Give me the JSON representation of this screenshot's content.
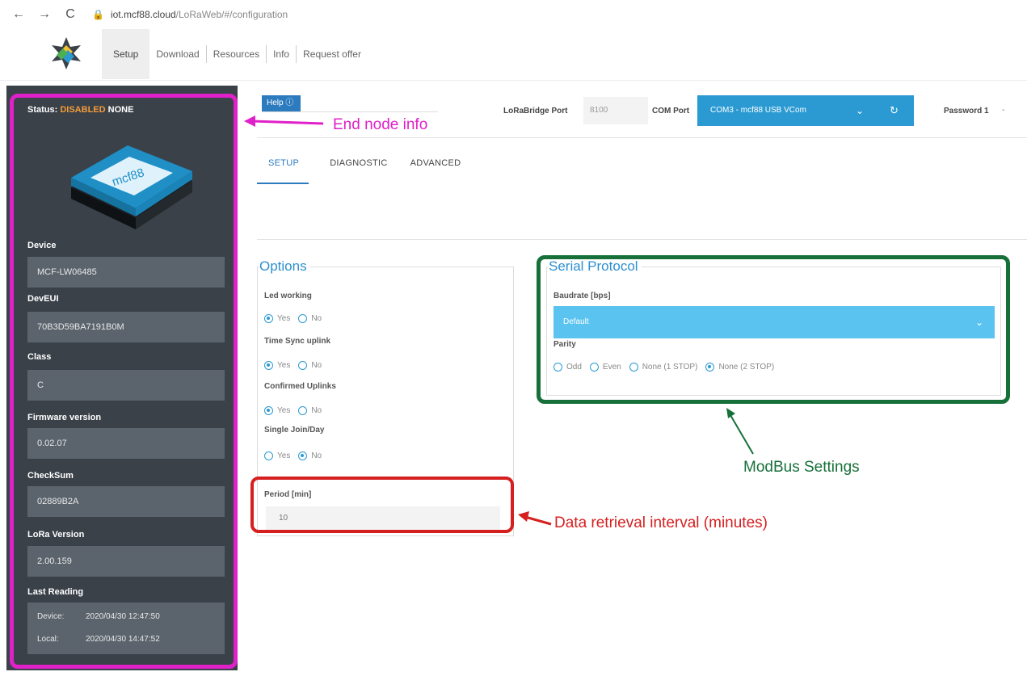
{
  "browser": {
    "back_icon": "←",
    "forward_icon": "→",
    "reload_icon": "C",
    "lock_icon": "🔒",
    "url_host": "iot.mcf88.cloud",
    "url_path": "/LoRaWeb/#/configuration"
  },
  "header": {
    "tabs": [
      "Setup",
      "Download",
      "Resources",
      "Info",
      "Request offer"
    ]
  },
  "sidebar": {
    "status_label": "Status:",
    "status_state": "DISABLED",
    "status_mode": "NONE",
    "device_label": "Device",
    "device_value": "MCF-LW06485",
    "deveui_label": "DevEUI",
    "deveui_value": "70B3D59BA7191B0M",
    "class_label": "Class",
    "class_value": "C",
    "firmware_label": "Firmware version",
    "firmware_value": "0.02.07",
    "checksum_label": "CheckSum",
    "checksum_value": "02889B2A",
    "lora_label": "LoRa Version",
    "lora_value": "2.00.159",
    "last_reading_label": "Last Reading",
    "reading_device_key": "Device:",
    "reading_device_value": "2020/04/30 12:47:50",
    "reading_local_key": "Local:",
    "reading_local_value": "2020/04/30 14:47:52",
    "device_logo_text": "mcf88"
  },
  "topbar": {
    "help_label": "Help ⓘ",
    "lorabridge_port_label": "LoRaBridge Port",
    "lorabridge_port_value": "8100",
    "com_port_label": "COM Port",
    "com_port_value": "COM3 - mcf88 USB VCom",
    "password_label": "Password 1",
    "password_value": "-",
    "chevron_icon": "⌄",
    "refresh_icon": "↻"
  },
  "subtabs": [
    "SETUP",
    "DIAGNOSTIC",
    "ADVANCED"
  ],
  "options": {
    "legend": "Options",
    "led_label": "Led working",
    "timesync_label": "Time Sync uplink",
    "confirmed_label": "Confirmed Uplinks",
    "singlejoin_label": "Single Join/Day",
    "yes": "Yes",
    "no": "No",
    "period_label": "Period [min]",
    "period_value": "10"
  },
  "serial": {
    "legend": "Serial Protocol",
    "baudrate_label": "Baudrate [bps]",
    "baudrate_value": "Default",
    "parity_label": "Parity",
    "parity_options": [
      "Odd",
      "Even",
      "None (1 STOP)",
      "None (2 STOP)"
    ]
  },
  "annotations": {
    "end_node": "End node info",
    "modbus": "ModBus Settings",
    "interval": "Data retrieval interval (minutes)",
    "magenta": "#e020c8",
    "green": "#17703a",
    "red": "#d62020"
  }
}
